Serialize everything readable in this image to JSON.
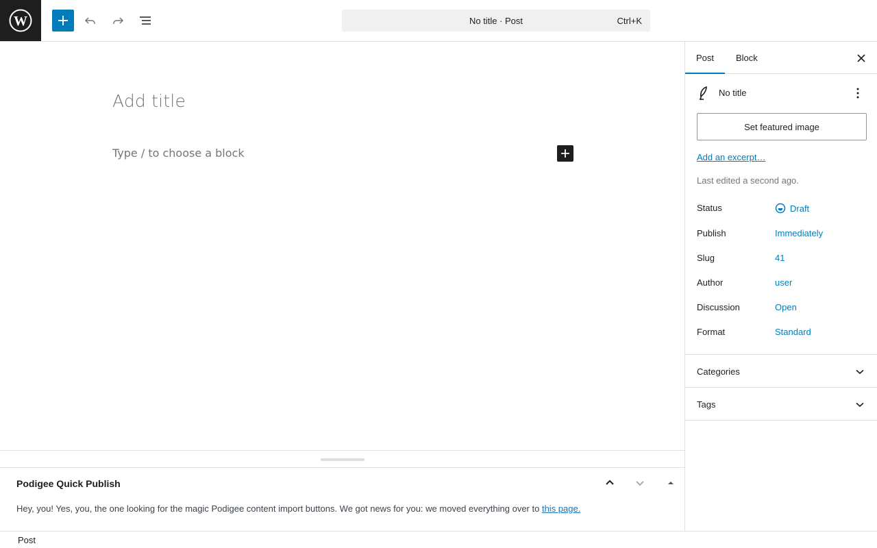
{
  "header": {
    "command_bar": {
      "title": "No title · Post",
      "shortcut": "Ctrl+K"
    }
  },
  "editor": {
    "title_placeholder": "Add title",
    "block_placeholder": "Type / to choose a block"
  },
  "metabox": {
    "title": "Podigee Quick Publish",
    "text": "Hey, you! Yes, you, the one looking for the magic Podigee content import buttons. We got news for you: we moved everything over to ",
    "link_label": "this page."
  },
  "footer": {
    "breadcrumb": "Post"
  },
  "sidebar": {
    "tabs": [
      {
        "label": "Post"
      },
      {
        "label": "Block"
      }
    ],
    "post_title": "No title",
    "featured_image_label": "Set featured image",
    "excerpt_label": "Add an excerpt…",
    "last_edited": "Last edited a second ago.",
    "rows": [
      {
        "label": "Status",
        "value": "Draft"
      },
      {
        "label": "Publish",
        "value": "Immediately"
      },
      {
        "label": "Slug",
        "value": "41"
      },
      {
        "label": "Author",
        "value": "user"
      },
      {
        "label": "Discussion",
        "value": "Open"
      },
      {
        "label": "Format",
        "value": "Standard"
      }
    ],
    "panels": [
      {
        "title": "Categories"
      },
      {
        "title": "Tags"
      }
    ]
  },
  "colors": {
    "accent": "#007cba",
    "dark": "#1e1e1e",
    "border": "#e0e0e0"
  }
}
